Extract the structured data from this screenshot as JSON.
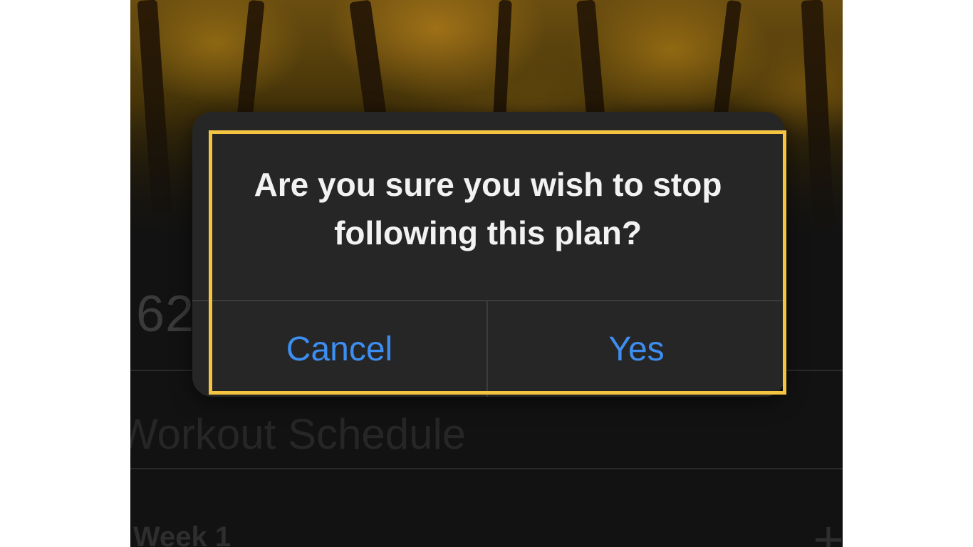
{
  "background": {
    "stat_number": "62",
    "section_title": "Workout Schedule",
    "week_label": "Week 1",
    "add_icon": "plus-icon"
  },
  "dialog": {
    "message": "Are you sure you wish to stop following this plan?",
    "cancel_label": "Cancel",
    "confirm_label": "Yes"
  },
  "colors": {
    "button_accent": "#3d8ef0",
    "highlight_border": "#f5c542",
    "dialog_background": "#262626"
  }
}
